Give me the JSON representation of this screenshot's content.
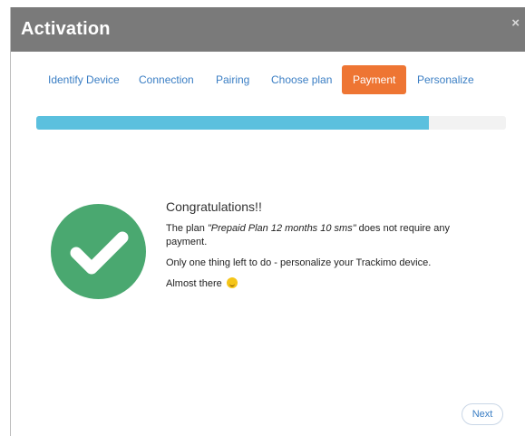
{
  "modal": {
    "title": "Activation",
    "close_glyph": "×"
  },
  "steps": [
    {
      "label": "Identify Device",
      "active": false
    },
    {
      "label": "Connection",
      "active": false
    },
    {
      "label": "Pairing",
      "active": false
    },
    {
      "label": "Choose plan",
      "active": false
    },
    {
      "label": "Payment",
      "active": true
    },
    {
      "label": "Personalize",
      "active": false
    }
  ],
  "progress": {
    "fraction": 0.835,
    "fill_color": "#5bc0de",
    "track_color": "#f2f2f2"
  },
  "message": {
    "heading": "Congratulations!!",
    "plan_prefix": "The plan ",
    "plan_name": "\"Prepaid Plan 12 months 10 sms\"",
    "plan_suffix": " does not require any payment.",
    "line2": "Only one thing left to do - personalize your Trackimo device.",
    "line3": "Almost there",
    "line3_icon": "smile-emoji-icon"
  },
  "icons": {
    "success": "check-circle-icon",
    "close": "close-icon"
  },
  "colors": {
    "header": "#7a7a7a",
    "active_step": "#ee7533",
    "link": "#3a7ec4",
    "success": "#4aa870"
  },
  "footer": {
    "next_label": "Next"
  }
}
